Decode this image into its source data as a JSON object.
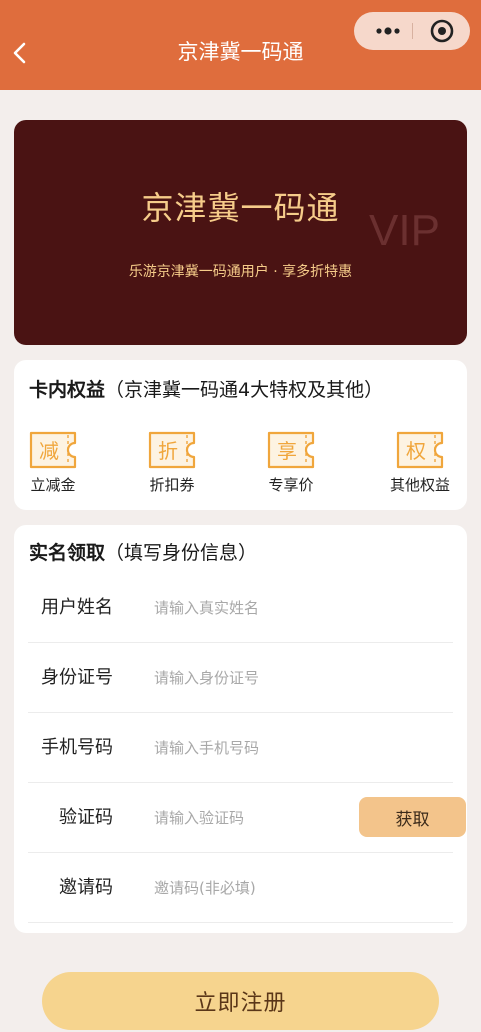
{
  "navbar": {
    "title": "京津冀一码通",
    "color": "#df6d3d"
  },
  "vip_card": {
    "title": "京津冀一码通",
    "subtitle": "乐游京津冀一码通用户 · 享多折特惠",
    "badge": "VIP",
    "bg_color": "#4a1313",
    "text_color": "#f6cc8a"
  },
  "benefits": {
    "title": "卡内权益",
    "subtitle": "（京津冀一码通4大特权及其他）",
    "items": [
      {
        "glyph": "减",
        "label": "立减金",
        "icon": "coupon-ticket-icon"
      },
      {
        "glyph": "折",
        "label": "折扣券",
        "icon": "coupon-ticket-icon"
      },
      {
        "glyph": "享",
        "label": "专享价",
        "icon": "coupon-ticket-icon"
      },
      {
        "glyph": "权",
        "label": "其他权益",
        "icon": "coupon-ticket-icon"
      }
    ],
    "accent": "#f0a63c"
  },
  "form": {
    "title": "实名领取",
    "subtitle": "（填写身份信息）",
    "fields": [
      {
        "label": "用户姓名",
        "placeholder": "请输入真实姓名"
      },
      {
        "label": "身份证号",
        "placeholder": "请输入身份证号"
      },
      {
        "label": "手机号码",
        "placeholder": "请输入手机号码"
      },
      {
        "label": "验证码",
        "placeholder": "请输入验证码"
      },
      {
        "label": "邀请码",
        "placeholder": "邀请码(非必填)"
      }
    ],
    "get_code_label": "获取"
  },
  "submit_label": "立即注册"
}
